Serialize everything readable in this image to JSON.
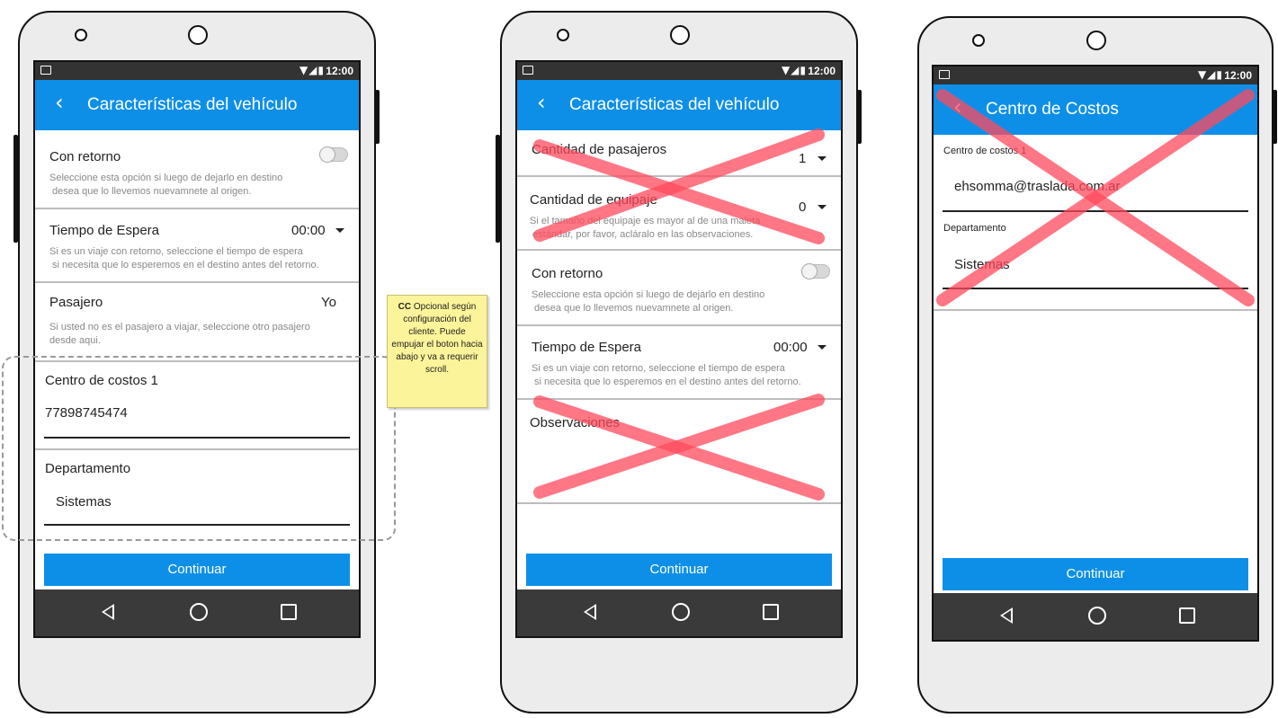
{
  "status_bar": {
    "time": "12:00",
    "icons": "▼◢▮"
  },
  "phone1": {
    "title": "Características del vehículo",
    "con_retorno": {
      "label": "Con retorno",
      "hint": "Seleccione esta opción si luego de dejarlo en destino\n desea que lo llevemos nuevamnete al origen."
    },
    "tiempo_espera": {
      "label": "Tiempo de Espera",
      "value": "00:00",
      "hint": "Si es un viaje con retorno, seleccione el tiempo de espera\n si necesita que lo esperemos en el destino antes del retorno."
    },
    "pasajero": {
      "label": "Pasajero",
      "value": "Yo",
      "hint": "Si usted no es el pasajero a viajar, seleccione otro pasajero\ndesde aqui."
    },
    "centro_costos": {
      "label": "Centro de costos 1",
      "value": "77898745474"
    },
    "departamento": {
      "label": "Departamento",
      "value": "Sistemas"
    },
    "button": "Continuar"
  },
  "note": {
    "bold": "CC",
    "text": " Opcional según configuración del cliente. Puede empujar el boton hacia abajo y va a requerir scroll."
  },
  "phone2": {
    "title": "Características del vehículo",
    "cantidad_pasajeros": {
      "label": "Cantidad de pasajeros",
      "value": "1"
    },
    "cantidad_equipaje": {
      "label": "Cantidad de equipaje",
      "value": "0",
      "hint": "Si el tamaño del equipaje es mayor al de una maleta\n estándar, por favor, acláralo en las observaciones."
    },
    "con_retorno": {
      "label": "Con retorno",
      "hint": "Seleccione esta opción si luego de dejarlo en destino\n desea que lo llevemos nuevamnete al origen."
    },
    "tiempo_espera": {
      "label": "Tiempo de Espera",
      "value": "00:00",
      "hint": "Si es un viaje con retorno, seleccione el tiempo de espera\n si necesita que lo esperemos en el destino antes del retorno."
    },
    "observaciones": {
      "label": "Observaciones"
    },
    "button": "Continuar"
  },
  "phone3": {
    "title": "Centro de Costos",
    "centro_costos": {
      "label": "Centro de costos 1",
      "value": "ehsomma@traslada.com.ar"
    },
    "departamento": {
      "label": "Departamento",
      "value": "Sistemas"
    },
    "button": "Continuar"
  },
  "colors": {
    "accent": "#0d8fe8",
    "cross": "#ff5a6a",
    "note": "#fbf49a"
  }
}
